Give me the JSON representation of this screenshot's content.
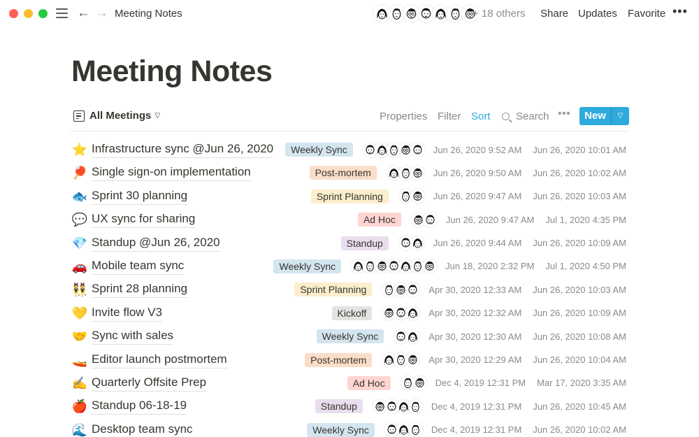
{
  "window": {
    "breadcrumb": "Meeting Notes",
    "others_label": "+ 18 others",
    "collaborator_count_shown": 7,
    "actions": {
      "share": "Share",
      "updates": "Updates",
      "favorite": "Favorite",
      "more": "•••"
    }
  },
  "page": {
    "title": "Meeting Notes"
  },
  "view": {
    "name": "All Meetings",
    "toolbar": {
      "properties": "Properties",
      "filter": "Filter",
      "sort": "Sort",
      "search": "Search",
      "more": "•••",
      "new": "New",
      "new_dropdown": "⌄"
    }
  },
  "colors": {
    "accent": "#2eaadc",
    "tags": {
      "Weekly Sync": "#d3e5ef",
      "Post-mortem": "#fadec9",
      "Sprint Planning": "#fbeecc",
      "Ad Hoc": "#ffd5d2",
      "Standup": "#e8deee",
      "Kickoff": "#e3e2e0"
    }
  },
  "rows": [
    {
      "emoji": "⭐",
      "icon": "star-icon",
      "title": "Infrastructure sync @Jun 26, 2020",
      "tag": "Weekly Sync",
      "people": 5,
      "created": "Jun 26, 2020 9:52 AM",
      "edited": "Jun 26, 2020 10:01 AM"
    },
    {
      "emoji": "🏓",
      "icon": "ping-pong-icon",
      "title": "Single sign-on implementation",
      "tag": "Post-mortem",
      "people": 3,
      "created": "Jun 26, 2020 9:50 AM",
      "edited": "Jun 26, 2020 10:02 AM"
    },
    {
      "emoji": "🐟",
      "icon": "fish-icon",
      "title": "Sprint 30 planning",
      "tag": "Sprint Planning",
      "people": 2,
      "created": "Jun 26, 2020 9:47 AM",
      "edited": "Jun 26, 2020 10:03 AM"
    },
    {
      "emoji": "💬",
      "icon": "speech-bubble-icon",
      "title": "UX sync for sharing",
      "tag": "Ad Hoc",
      "people": 2,
      "created": "Jun 26, 2020 9:47 AM",
      "edited": "Jul 1, 2020 4:35 PM"
    },
    {
      "emoji": "💎",
      "icon": "gem-icon",
      "title": "Standup @Jun 26, 2020",
      "tag": "Standup",
      "people": 2,
      "created": "Jun 26, 2020 9:44 AM",
      "edited": "Jun 26, 2020 10:09 AM"
    },
    {
      "emoji": "🚗",
      "icon": "car-icon",
      "title": "Mobile team sync",
      "tag": "Weekly Sync",
      "people": 7,
      "created": "Jun 18, 2020 2:32 PM",
      "edited": "Jul 1, 2020 4:50 PM"
    },
    {
      "emoji": "👯",
      "icon": "dancers-icon",
      "title": "Sprint 28 planning",
      "tag": "Sprint Planning",
      "people": 3,
      "created": "Apr 30, 2020 12:33 AM",
      "edited": "Jun 26, 2020 10:03 AM"
    },
    {
      "emoji": "💛",
      "icon": "yellow-heart-icon",
      "title": "Invite flow V3",
      "tag": "Kickoff",
      "people": 3,
      "created": "Apr 30, 2020 12:32 AM",
      "edited": "Jun 26, 2020 10:09 AM"
    },
    {
      "emoji": "🤝",
      "icon": "handshake-icon",
      "title": "Sync with sales",
      "tag": "Weekly Sync",
      "people": 2,
      "created": "Apr 30, 2020 12:30 AM",
      "edited": "Jun 26, 2020 10:08 AM"
    },
    {
      "emoji": "🚤",
      "icon": "speedboat-icon",
      "title": "Editor launch postmortem",
      "tag": "Post-mortem",
      "people": 3,
      "created": "Apr 30, 2020 12:29 AM",
      "edited": "Jun 26, 2020 10:04 AM"
    },
    {
      "emoji": "✍️",
      "icon": "writing-hand-icon",
      "title": "Quarterly Offsite Prep",
      "tag": "Ad Hoc",
      "people": 2,
      "created": "Dec 4, 2019 12:31 PM",
      "edited": "Mar 17, 2020 3:35 AM"
    },
    {
      "emoji": "🍎",
      "icon": "apple-icon",
      "title": "Standup 06-18-19",
      "tag": "Standup",
      "people": 4,
      "created": "Dec 4, 2019 12:31 PM",
      "edited": "Jun 26, 2020 10:45 AM"
    },
    {
      "emoji": "🌊",
      "icon": "wave-icon",
      "title": "Desktop team sync",
      "tag": "Weekly Sync",
      "people": 3,
      "created": "Dec 4, 2019 12:31 PM",
      "edited": "Jun 26, 2020 10:02 AM"
    }
  ]
}
